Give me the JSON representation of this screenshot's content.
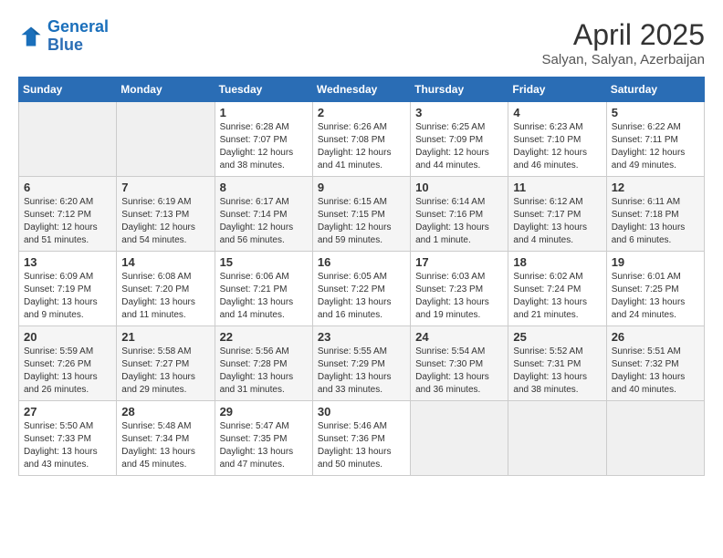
{
  "header": {
    "logo_line1": "General",
    "logo_line2": "Blue",
    "month": "April 2025",
    "location": "Salyan, Salyan, Azerbaijan"
  },
  "weekdays": [
    "Sunday",
    "Monday",
    "Tuesday",
    "Wednesday",
    "Thursday",
    "Friday",
    "Saturday"
  ],
  "weeks": [
    [
      {
        "day": "",
        "info": ""
      },
      {
        "day": "",
        "info": ""
      },
      {
        "day": "1",
        "info": "Sunrise: 6:28 AM\nSunset: 7:07 PM\nDaylight: 12 hours\nand 38 minutes."
      },
      {
        "day": "2",
        "info": "Sunrise: 6:26 AM\nSunset: 7:08 PM\nDaylight: 12 hours\nand 41 minutes."
      },
      {
        "day": "3",
        "info": "Sunrise: 6:25 AM\nSunset: 7:09 PM\nDaylight: 12 hours\nand 44 minutes."
      },
      {
        "day": "4",
        "info": "Sunrise: 6:23 AM\nSunset: 7:10 PM\nDaylight: 12 hours\nand 46 minutes."
      },
      {
        "day": "5",
        "info": "Sunrise: 6:22 AM\nSunset: 7:11 PM\nDaylight: 12 hours\nand 49 minutes."
      }
    ],
    [
      {
        "day": "6",
        "info": "Sunrise: 6:20 AM\nSunset: 7:12 PM\nDaylight: 12 hours\nand 51 minutes."
      },
      {
        "day": "7",
        "info": "Sunrise: 6:19 AM\nSunset: 7:13 PM\nDaylight: 12 hours\nand 54 minutes."
      },
      {
        "day": "8",
        "info": "Sunrise: 6:17 AM\nSunset: 7:14 PM\nDaylight: 12 hours\nand 56 minutes."
      },
      {
        "day": "9",
        "info": "Sunrise: 6:15 AM\nSunset: 7:15 PM\nDaylight: 12 hours\nand 59 minutes."
      },
      {
        "day": "10",
        "info": "Sunrise: 6:14 AM\nSunset: 7:16 PM\nDaylight: 13 hours\nand 1 minute."
      },
      {
        "day": "11",
        "info": "Sunrise: 6:12 AM\nSunset: 7:17 PM\nDaylight: 13 hours\nand 4 minutes."
      },
      {
        "day": "12",
        "info": "Sunrise: 6:11 AM\nSunset: 7:18 PM\nDaylight: 13 hours\nand 6 minutes."
      }
    ],
    [
      {
        "day": "13",
        "info": "Sunrise: 6:09 AM\nSunset: 7:19 PM\nDaylight: 13 hours\nand 9 minutes."
      },
      {
        "day": "14",
        "info": "Sunrise: 6:08 AM\nSunset: 7:20 PM\nDaylight: 13 hours\nand 11 minutes."
      },
      {
        "day": "15",
        "info": "Sunrise: 6:06 AM\nSunset: 7:21 PM\nDaylight: 13 hours\nand 14 minutes."
      },
      {
        "day": "16",
        "info": "Sunrise: 6:05 AM\nSunset: 7:22 PM\nDaylight: 13 hours\nand 16 minutes."
      },
      {
        "day": "17",
        "info": "Sunrise: 6:03 AM\nSunset: 7:23 PM\nDaylight: 13 hours\nand 19 minutes."
      },
      {
        "day": "18",
        "info": "Sunrise: 6:02 AM\nSunset: 7:24 PM\nDaylight: 13 hours\nand 21 minutes."
      },
      {
        "day": "19",
        "info": "Sunrise: 6:01 AM\nSunset: 7:25 PM\nDaylight: 13 hours\nand 24 minutes."
      }
    ],
    [
      {
        "day": "20",
        "info": "Sunrise: 5:59 AM\nSunset: 7:26 PM\nDaylight: 13 hours\nand 26 minutes."
      },
      {
        "day": "21",
        "info": "Sunrise: 5:58 AM\nSunset: 7:27 PM\nDaylight: 13 hours\nand 29 minutes."
      },
      {
        "day": "22",
        "info": "Sunrise: 5:56 AM\nSunset: 7:28 PM\nDaylight: 13 hours\nand 31 minutes."
      },
      {
        "day": "23",
        "info": "Sunrise: 5:55 AM\nSunset: 7:29 PM\nDaylight: 13 hours\nand 33 minutes."
      },
      {
        "day": "24",
        "info": "Sunrise: 5:54 AM\nSunset: 7:30 PM\nDaylight: 13 hours\nand 36 minutes."
      },
      {
        "day": "25",
        "info": "Sunrise: 5:52 AM\nSunset: 7:31 PM\nDaylight: 13 hours\nand 38 minutes."
      },
      {
        "day": "26",
        "info": "Sunrise: 5:51 AM\nSunset: 7:32 PM\nDaylight: 13 hours\nand 40 minutes."
      }
    ],
    [
      {
        "day": "27",
        "info": "Sunrise: 5:50 AM\nSunset: 7:33 PM\nDaylight: 13 hours\nand 43 minutes."
      },
      {
        "day": "28",
        "info": "Sunrise: 5:48 AM\nSunset: 7:34 PM\nDaylight: 13 hours\nand 45 minutes."
      },
      {
        "day": "29",
        "info": "Sunrise: 5:47 AM\nSunset: 7:35 PM\nDaylight: 13 hours\nand 47 minutes."
      },
      {
        "day": "30",
        "info": "Sunrise: 5:46 AM\nSunset: 7:36 PM\nDaylight: 13 hours\nand 50 minutes."
      },
      {
        "day": "",
        "info": ""
      },
      {
        "day": "",
        "info": ""
      },
      {
        "day": "",
        "info": ""
      }
    ]
  ]
}
